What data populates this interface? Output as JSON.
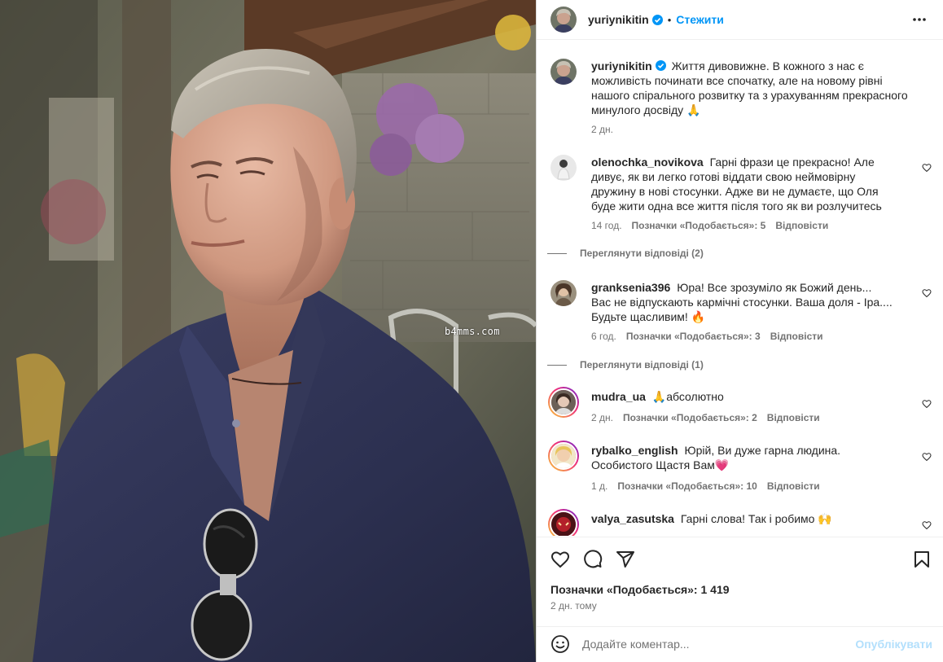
{
  "post": {
    "author": "yuriynikitin",
    "follow_label": "Стежити",
    "dot": "•",
    "more_icon": "more-horizontal-icon",
    "watermark": "b4mms.com",
    "caption": {
      "text": "Життя дивовижне. В кожного з нас є можливість починати все спочатку, але на новому рівні нашого спірального розвитку та з урахуванням прекрасного минулого досвіду 🙏",
      "time": "2 дн."
    }
  },
  "comments": [
    {
      "user": "olenochka_novikova",
      "text": "Гарні фрази це прекрасно! Але дивує, як ви легко готові віддати свою неймовірну дружину в нові стосунки. Адже ви не думаєте, що Оля буде жити одна все життя після того як ви розлучитесь",
      "time": "14 год.",
      "likes": "Позначки «Подобається»: 5",
      "reply": "Відповісти",
      "view_replies": "Переглянути відповіді (2)"
    },
    {
      "user": "granksenia396",
      "text": "Юра! Все зрозуміло як Божий день... Вас не відпускають кармічні стосунки. Ваша доля - Іра.... Будьте щасливим! 🔥",
      "time": "6 год.",
      "likes": "Позначки «Подобається»: 3",
      "reply": "Відповісти",
      "view_replies": "Переглянути відповіді (1)"
    },
    {
      "user": "mudra_ua",
      "text": "🙏абсолютно",
      "time": "2 дн.",
      "likes": "Позначки «Подобається»: 2",
      "reply": "Відповісти"
    },
    {
      "user": "rybalko_english",
      "text": "Юрій, Ви дуже гарна людина. Особистого Щастя Вам💗",
      "time": "1 д.",
      "likes": "Позначки «Подобається»: 10",
      "reply": "Відповісти"
    },
    {
      "user": "valya_zasutska",
      "text": "Гарні слова! Так і робимо 🙌"
    }
  ],
  "actions": {
    "likes_text": "Позначки «Подобається»: 1 419",
    "date": "2 дн. тому",
    "icons": [
      "heart-icon",
      "comment-icon",
      "share-icon",
      "bookmark-icon"
    ]
  },
  "composer": {
    "placeholder": "Додайте коментар...",
    "value": "",
    "post_label": "Опублікувати"
  },
  "colors": {
    "accent": "#0095f6",
    "post_disabled": "#b2dffc",
    "muted": "#737373",
    "text": "#262626",
    "border": "#dbdbdb"
  }
}
